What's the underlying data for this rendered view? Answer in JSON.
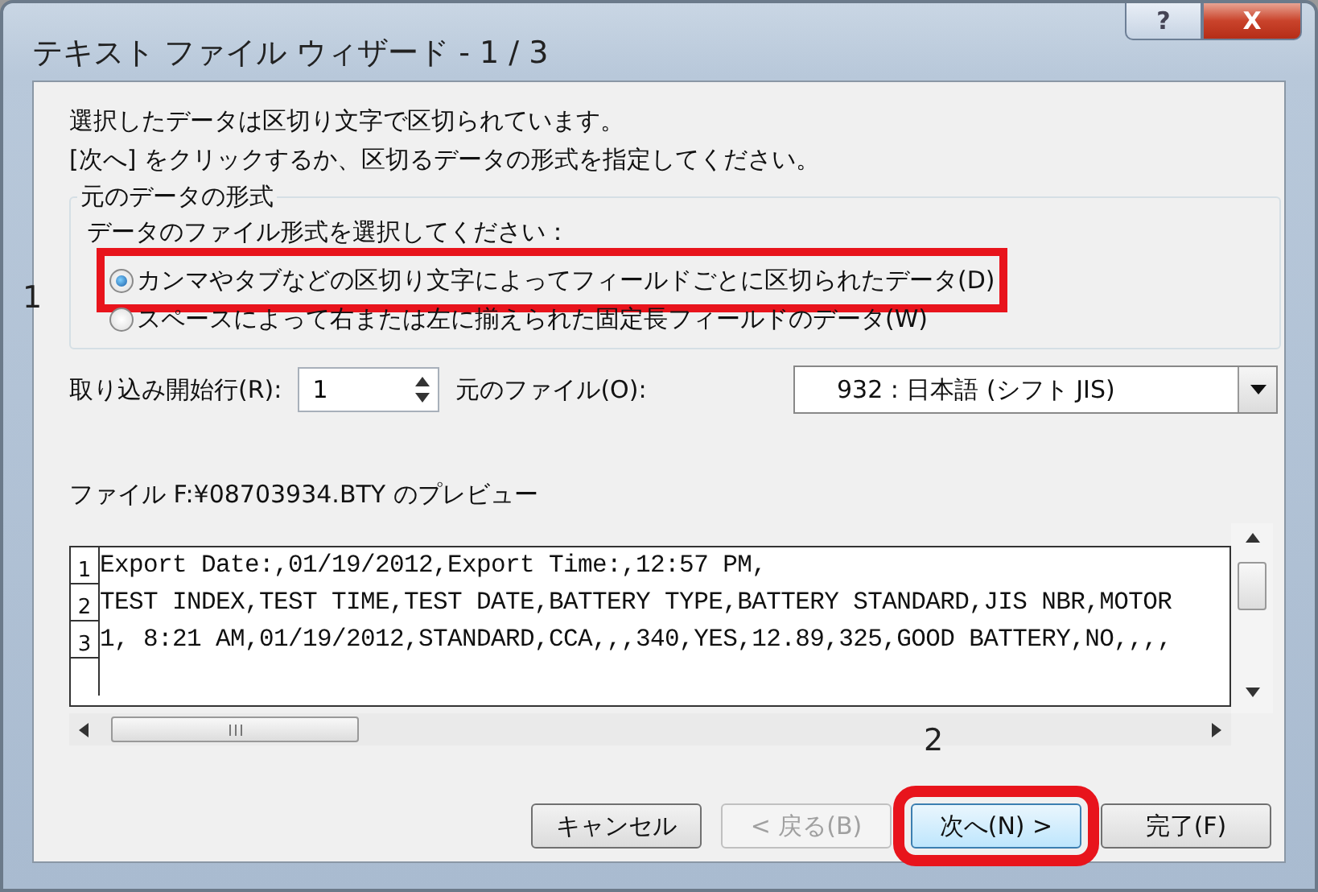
{
  "window": {
    "title": "テキスト ファイル ウィザード - 1 / 3",
    "title_buttons": [
      {
        "kind": "help",
        "label": "?"
      },
      {
        "kind": "close",
        "label": "X"
      }
    ]
  },
  "intro": [
    "選択したデータは区切り文字で区切られています。",
    "[次へ] をクリックするか、区切るデータの形式を指定してください。"
  ],
  "group": {
    "title": "元のデータの形式",
    "prompt": "データのファイル形式を選択してください：",
    "marker": "1",
    "options": [
      {
        "label": "カンマやタブなどの区切り文字によってフィールドごとに区切られたデータ(D)",
        "selected": true,
        "highlighted": true
      },
      {
        "label": "スペースによって右または左に揃えられた固定長フィールドのデータ(W)",
        "selected": false,
        "highlighted": false
      }
    ]
  },
  "start_row": {
    "label": "取り込み開始行(R):",
    "value": "1"
  },
  "origin": {
    "label": "元のファイル(O):",
    "value": "932 : 日本語 (シフト JIS)"
  },
  "preview": {
    "title": "ファイル F:¥08703934.BTY のプレビュー",
    "rows": [
      {
        "number": "1",
        "text": "Export Date:,01/19/2012,Export Time:,12:57 PM,"
      },
      {
        "number": "2",
        "text": "TEST INDEX,TEST TIME,TEST DATE,BATTERY TYPE,BATTERY STANDARD,JIS NBR,MOTOR"
      },
      {
        "number": "3",
        "text": "1, 8:21 AM,01/19/2012,STANDARD,CCA,,,340,YES,12.89,325,GOOD BATTERY,NO,,,,"
      }
    ]
  },
  "buttons_marker": "2",
  "buttons": [
    {
      "label": "キャンセル",
      "disabled": false,
      "highlighted": false
    },
    {
      "label": "< 戻る(B)",
      "disabled": true,
      "highlighted": false
    },
    {
      "label": "次へ(N) >",
      "disabled": false,
      "highlighted": true
    },
    {
      "label": "完了(F)",
      "disabled": false,
      "highlighted": false
    }
  ]
}
